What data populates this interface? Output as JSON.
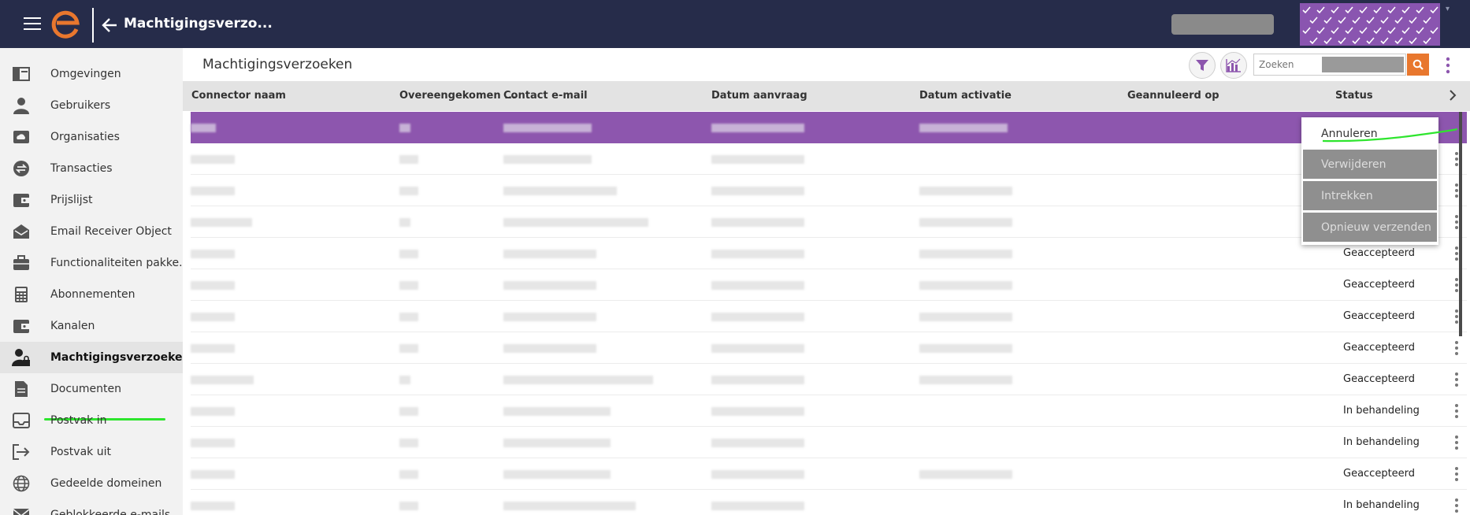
{
  "header": {
    "title": "Machtigingsverzo...",
    "colors": {
      "bar": "#262c4a",
      "logo": "#e8772e",
      "pattern": "#8a55b0"
    }
  },
  "sidebar": {
    "items": [
      {
        "label": "Omgevingen",
        "icon": "environment-icon"
      },
      {
        "label": "Gebruikers",
        "icon": "user-icon"
      },
      {
        "label": "Organisaties",
        "icon": "cloud-box-icon"
      },
      {
        "label": "Transacties",
        "icon": "transactions-icon"
      },
      {
        "label": "Prijslijst",
        "icon": "wallet-icon"
      },
      {
        "label": "Email Receiver Object",
        "icon": "email-receiver-icon"
      },
      {
        "label": "Functionaliteiten pakke...",
        "icon": "briefcase-icon"
      },
      {
        "label": "Abonnementen",
        "icon": "calculator-icon"
      },
      {
        "label": "Kanalen",
        "icon": "channel-icon"
      },
      {
        "label": "Machtigingsverzoeken",
        "icon": "user-lock-icon",
        "active": true
      },
      {
        "label": "Documenten",
        "icon": "document-icon"
      },
      {
        "label": "Postvak in",
        "icon": "inbox-icon"
      },
      {
        "label": "Postvak uit",
        "icon": "outbox-icon"
      },
      {
        "label": "Gedeelde domeinen",
        "icon": "globe-icon"
      },
      {
        "label": "Geblokkeerde e-mails",
        "icon": "blocked-mail-icon"
      }
    ]
  },
  "main": {
    "page_title": "Machtigingsverzoeken",
    "search": {
      "placeholder": "Zoeken"
    },
    "columns": [
      "Connector naam",
      "Overeengekomen ...",
      "Contact e-mail",
      "Datum aanvraag",
      "Datum activatie",
      "Geannuleerd op",
      "Status"
    ],
    "rows": [
      {
        "status": "",
        "selected": true
      },
      {
        "status": ""
      },
      {
        "status": ""
      },
      {
        "status": ""
      },
      {
        "status": "Geaccepteerd"
      },
      {
        "status": "Geaccepteerd"
      },
      {
        "status": "Geaccepteerd"
      },
      {
        "status": "Geaccepteerd"
      },
      {
        "status": "Geaccepteerd"
      },
      {
        "status": "In behandeling"
      },
      {
        "status": "In behandeling"
      },
      {
        "status": "Geaccepteerd"
      },
      {
        "status": "In behandeling"
      }
    ],
    "selected_row_color": "#8d56ae"
  },
  "context_menu": {
    "items": [
      "Annuleren",
      "Verwijderen",
      "Intrekken",
      "Opnieuw verzenden"
    ]
  }
}
